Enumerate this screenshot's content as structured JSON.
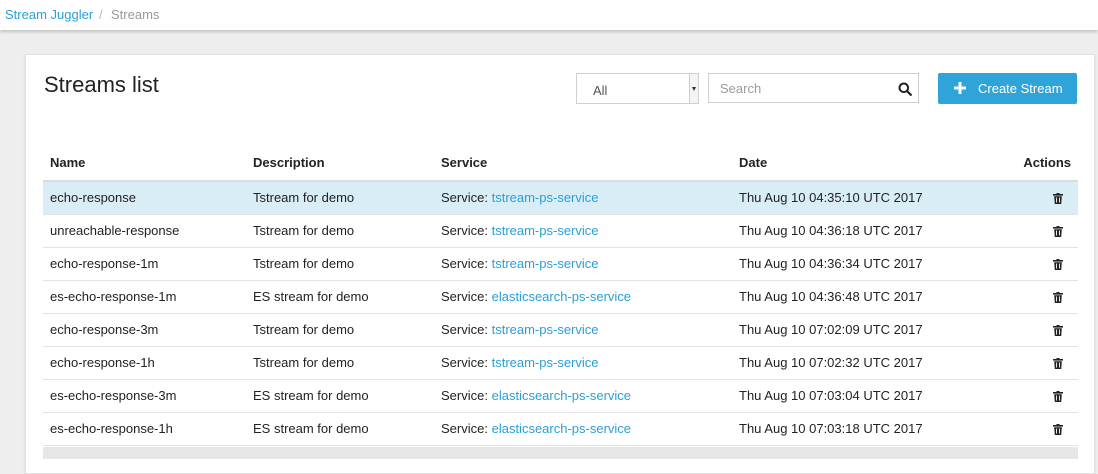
{
  "breadcrumb": {
    "home": "Stream Juggler",
    "separator": "/",
    "current": "Streams"
  },
  "page": {
    "title": "Streams list"
  },
  "filter": {
    "selected": "All"
  },
  "search": {
    "placeholder": "Search",
    "value": ""
  },
  "create_button": {
    "label": "Create Stream",
    "icon": "plus-icon"
  },
  "table": {
    "headers": {
      "name": "Name",
      "description": "Description",
      "service": "Service",
      "date": "Date",
      "actions": "Actions"
    },
    "service_prefix": "Service:",
    "rows": [
      {
        "name": "echo-response",
        "description": "Tstream for demo",
        "service": "tstream-ps-service",
        "date": "Thu Aug 10 04:35:10 UTC 2017",
        "selected": true
      },
      {
        "name": "unreachable-response",
        "description": "Tstream for demo",
        "service": "tstream-ps-service",
        "date": "Thu Aug 10 04:36:18 UTC 2017",
        "selected": false
      },
      {
        "name": "echo-response-1m",
        "description": "Tstream for demo",
        "service": "tstream-ps-service",
        "date": "Thu Aug 10 04:36:34 UTC 2017",
        "selected": false
      },
      {
        "name": "es-echo-response-1m",
        "description": "ES stream for demo",
        "service": "elasticsearch-ps-service",
        "date": "Thu Aug 10 04:36:48 UTC 2017",
        "selected": false
      },
      {
        "name": "echo-response-3m",
        "description": "Tstream for demo",
        "service": "tstream-ps-service",
        "date": "Thu Aug 10 07:02:09 UTC 2017",
        "selected": false
      },
      {
        "name": "echo-response-1h",
        "description": "Tstream for demo",
        "service": "tstream-ps-service",
        "date": "Thu Aug 10 07:02:32 UTC 2017",
        "selected": false
      },
      {
        "name": "es-echo-response-3m",
        "description": "ES stream for demo",
        "service": "elasticsearch-ps-service",
        "date": "Thu Aug 10 07:03:04 UTC 2017",
        "selected": false
      },
      {
        "name": "es-echo-response-1h",
        "description": "ES stream for demo",
        "service": "elasticsearch-ps-service",
        "date": "Thu Aug 10 07:03:18 UTC 2017",
        "selected": false
      }
    ]
  },
  "colors": {
    "accent": "#2fa4d8",
    "link": "#2a9fd6",
    "selected_row": "#d9edf6"
  }
}
